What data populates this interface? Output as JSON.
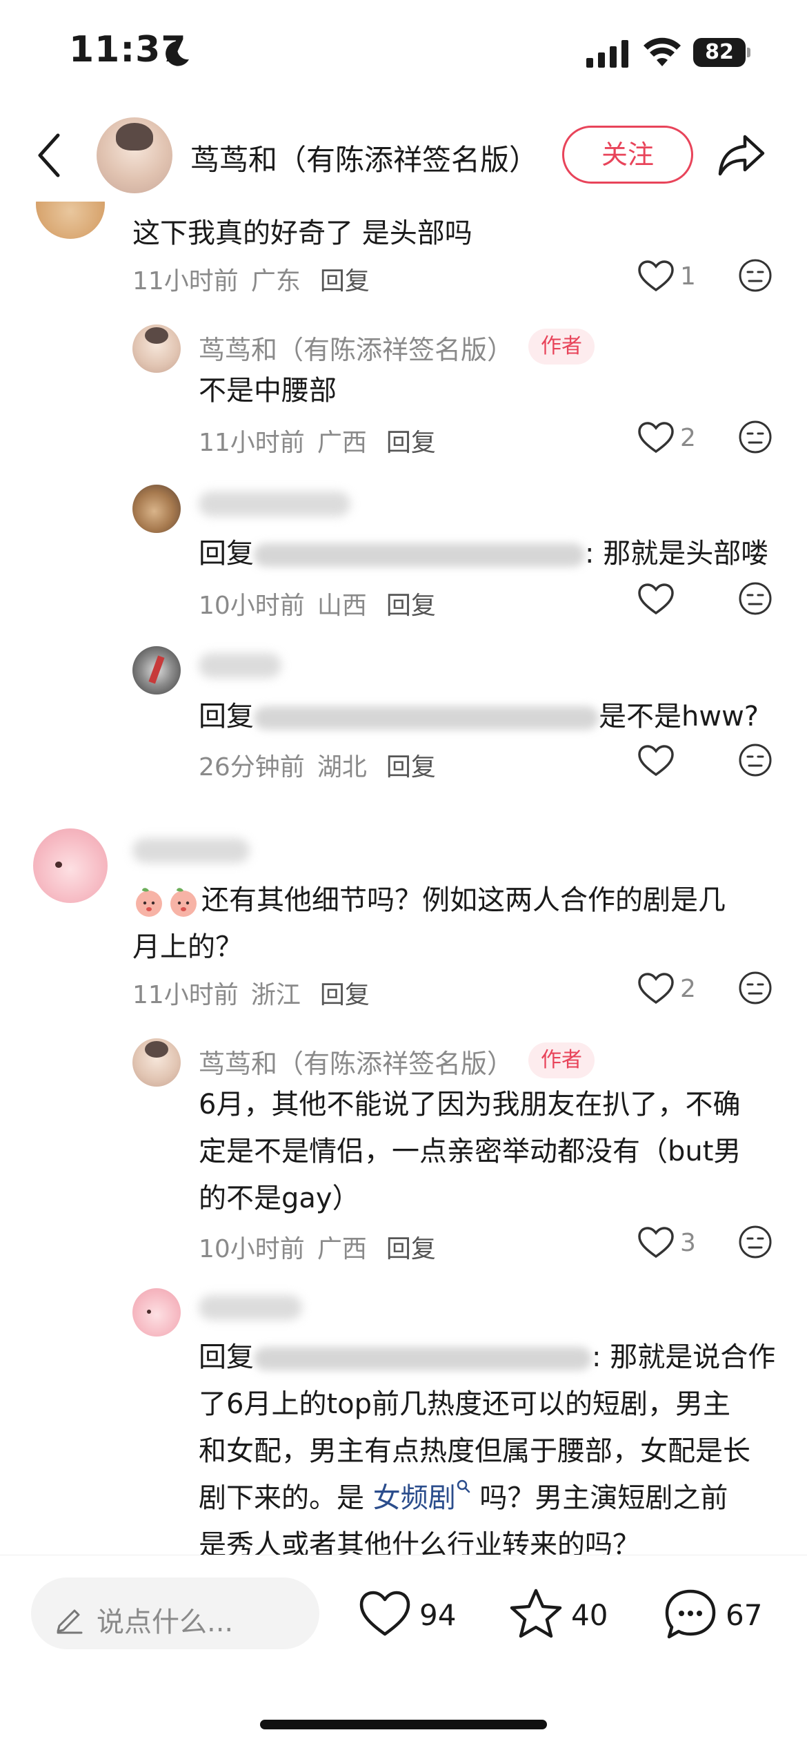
{
  "status_bar": {
    "time": "11:37",
    "battery": "82"
  },
  "header": {
    "account_name": "茑茑和（有陈添祥签名版）",
    "follow_label": "关注"
  },
  "colors": {
    "accent": "#e8445a",
    "topic_link": "#2b4d8c",
    "meta_gray": "#8a8a8a"
  },
  "comments": [
    {
      "text": "这下我真的好奇了 是头部吗",
      "time": "11小时前",
      "location": "广东",
      "reply_label": "回复",
      "likes": "1",
      "replies": [
        {
          "author": "茑茑和（有陈添祥签名版）",
          "badge": "作者",
          "text": "不是中腰部",
          "time": "11小时前",
          "location": "广西",
          "reply_label": "回复",
          "likes": "2"
        },
        {
          "reply_prefix": "回复",
          "text": ": 那就是头部喽",
          "time": "10小时前",
          "location": "山西",
          "reply_label": "回复",
          "likes": ""
        },
        {
          "reply_prefix": "回复",
          "text": "是不是hww?",
          "time": "26分钟前",
          "location": "湖北",
          "reply_label": "回复",
          "likes": ""
        }
      ]
    },
    {
      "text_line1": "还有其他细节吗？例如这两人合作的剧是几",
      "text_line2": "月上的？",
      "time": "11小时前",
      "location": "浙江",
      "reply_label": "回复",
      "likes": "2",
      "replies": [
        {
          "author": "茑茑和（有陈添祥签名版）",
          "badge": "作者",
          "text_line1": "6月，其他不能说了因为我朋友在扒了，不确",
          "text_line2": "定是不是情侣，一点亲密举动都没有（but男",
          "text_line3": "的不是gay）",
          "time": "10小时前",
          "location": "广西",
          "reply_label": "回复",
          "likes": "3"
        },
        {
          "reply_prefix": "回复",
          "text_line1": ": 那就是说合作",
          "text_line2": "了6月上的top前几热度还可以的短剧，男主",
          "text_line3": "和女配，男主有点热度但属于腰部，女配是长",
          "text_line4_pre": "剧下来的。是 ",
          "topic": "女频剧",
          "text_line4_post": " 吗？男主演短剧之前",
          "text_line5": "是秀人或者其他什么行业转来的吗？"
        }
      ]
    }
  ],
  "bottom_bar": {
    "input_placeholder": "说点什么...",
    "likes": "94",
    "favorites": "40",
    "comments": "67"
  }
}
